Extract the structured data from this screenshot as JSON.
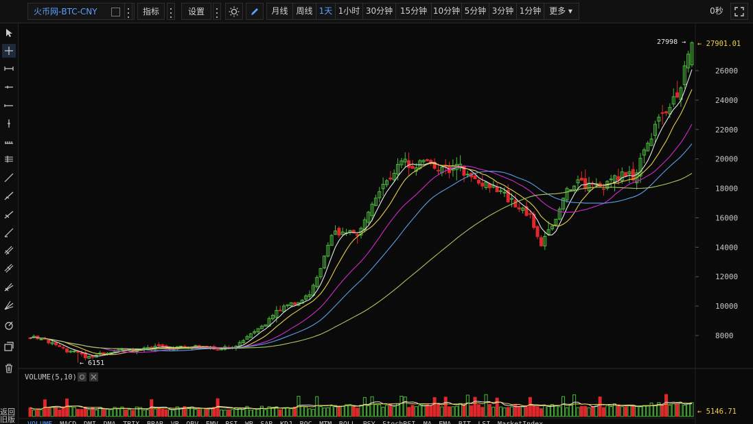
{
  "toolbar": {
    "symbol": "火币网-BTC-CNY",
    "indicators_label": "指标",
    "settings_label": "设置",
    "periods": [
      "月线",
      "周线",
      "1天",
      "1小时",
      "30分钟",
      "15分钟",
      "10分钟",
      "5分钟",
      "3分钟",
      "1分钟",
      "更多"
    ],
    "active_period": "1天",
    "timer": "0秒"
  },
  "left_tools": [
    "cursor-icon",
    "crosshair-icon",
    "segment-icon",
    "horizontal-ray-icon",
    "ray-icon",
    "vertical-line-icon",
    "price-range-icon",
    "parallel-lines-icon",
    "trend-line-icon",
    "angle-line-icon",
    "parallel-channel-icon",
    "extended-line-icon",
    "pitchfork-icon",
    "fib-retracement-icon",
    "fib-fan-icon",
    "gann-fan-icon",
    "spiral-icon",
    "stack-icon",
    "trash-icon"
  ],
  "back_label": "返回",
  "back_label2": "旧版",
  "price_axis": {
    "ticks": [
      "26000",
      "24000",
      "22000",
      "20000",
      "18000",
      "16000",
      "14000",
      "12000",
      "10000",
      "8000"
    ]
  },
  "price_labels": {
    "high_marker": "27998 →",
    "last_price": "← 27901.01",
    "low_marker": "← 6151"
  },
  "volume_panel": {
    "title": "VOLUME(5,10)",
    "last_value": "← 5146.71"
  },
  "indicator_tabs": [
    "VOLUME",
    "MACD",
    "DMI",
    "DMA",
    "TRIX",
    "BRAR",
    "VR",
    "OBV",
    "EMV",
    "RSI",
    "WR",
    "SAR",
    "KDJ",
    "ROC",
    "MTM",
    "BOLL",
    "PSY",
    "StochRSI",
    "MA",
    "EMA",
    "BIT",
    "LSI",
    "MarketIndex"
  ],
  "colors": {
    "up": "#4cbb3c",
    "down": "#e0282c",
    "ma5": "#e8e8e8",
    "ma10": "#e8d04c",
    "ma20": "#d02ad0",
    "ma30": "#5aa0e8",
    "ma60": "#a8c860",
    "accent": "#5aa0ff",
    "last_price": "#f0d040"
  },
  "chart_data": {
    "type": "candlestick",
    "y_axis_range": [
      6000,
      29000
    ],
    "y_ticks": [
      8000,
      10000,
      12000,
      14000,
      16000,
      18000,
      20000,
      22000,
      24000,
      26000
    ],
    "high": 27998,
    "low": 6151,
    "last": 27901.01,
    "close_path_anchors": [
      7900,
      7800,
      7400,
      7000,
      6800,
      6500,
      6700,
      6900,
      7000,
      7000,
      7100,
      7200,
      7200,
      7200,
      7300,
      7200,
      7100,
      7200,
      7400,
      8000,
      8600,
      9400,
      10200,
      10000,
      10800,
      12600,
      14800,
      15200,
      14800,
      16000,
      17500,
      18800,
      19800,
      19600,
      19800,
      19400,
      19200,
      19400,
      18600,
      18400,
      18000,
      17400,
      16800,
      16200,
      14200,
      15400,
      17600,
      18400,
      18200,
      18000,
      18400,
      19000,
      18800,
      20600,
      22400,
      23200,
      25000,
      27901
    ],
    "ma_lines": [
      "MA5",
      "MA10",
      "MA20",
      "MA30",
      "MA60"
    ]
  }
}
